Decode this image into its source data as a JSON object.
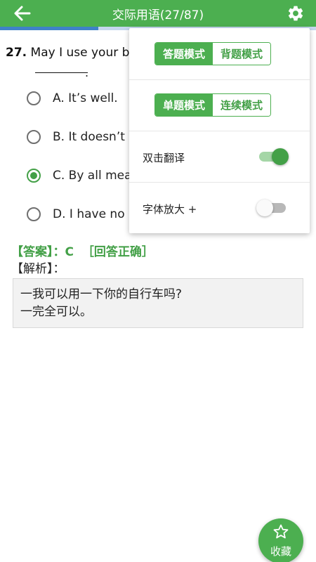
{
  "app_bar": {
    "title": "交际用语(27/87)",
    "back_icon": "arrow-left-icon",
    "settings_icon": "gear-icon",
    "color": "#4caf50"
  },
  "progress": {
    "current": 27,
    "total": 87,
    "fraction": 0.31,
    "color": "#3f82c8"
  },
  "question": {
    "number": "27.",
    "text": "May I use your b",
    "blank_suffix": "."
  },
  "options": [
    {
      "label": "A. It’s well.",
      "selected": false
    },
    {
      "label": "B. It doesn’t",
      "selected": false
    },
    {
      "label": "C. By all mea",
      "selected": true
    },
    {
      "label": "D. I have no",
      "selected": false
    }
  ],
  "answer": {
    "text": "【答案】：C  ［回答正确］",
    "color": "#43a047"
  },
  "analysis": {
    "label": "【解析】：",
    "lines": [
      "一我可以用一下你的自行车吗?",
      "一完全可以。"
    ]
  },
  "settings_popup": {
    "mode_group_1": {
      "options": [
        "答题模式",
        "背题模式"
      ],
      "active": "答题模式"
    },
    "mode_group_2": {
      "options": [
        "单题模式",
        "连续模式"
      ],
      "active": "单题模式"
    },
    "double_tap_translate": {
      "label": "双击翻译",
      "on": true
    },
    "font_enlarge": {
      "label": "字体放大 +",
      "on": false
    }
  },
  "fab": {
    "label": "收藏",
    "icon": "star-outline-icon"
  }
}
